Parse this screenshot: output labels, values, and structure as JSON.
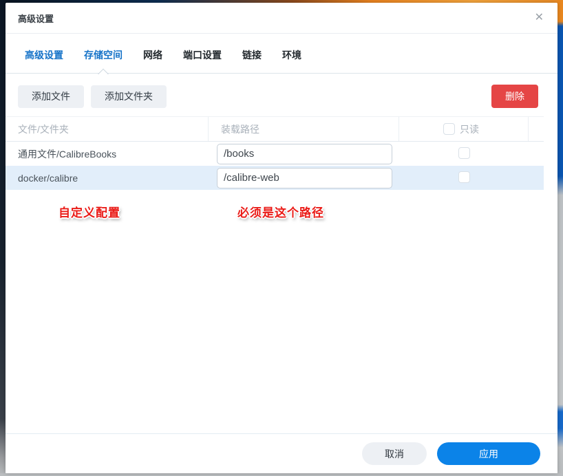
{
  "dialog": {
    "title": "高级设置",
    "close_icon": "✕"
  },
  "tabs": [
    {
      "label": "高级设置",
      "active": false
    },
    {
      "label": "存储空间",
      "active": true
    },
    {
      "label": "网络",
      "active": false
    },
    {
      "label": "端口设置",
      "active": false
    },
    {
      "label": "链接",
      "active": false
    },
    {
      "label": "环境",
      "active": false
    }
  ],
  "toolbar": {
    "add_file": "添加文件",
    "add_folder": "添加文件夹",
    "delete": "删除"
  },
  "table": {
    "headers": {
      "file": "文件/文件夹",
      "mount": "装载路径",
      "readonly": "只读"
    },
    "rows": [
      {
        "file": "通用文件/CalibreBooks",
        "mount_path": "/books",
        "readonly": false,
        "selected": false
      },
      {
        "file": "docker/calibre",
        "mount_path": "/calibre-web",
        "readonly": false,
        "selected": true
      }
    ]
  },
  "annotations": [
    {
      "text": "自定义配置"
    },
    {
      "text": "必须是这个路径"
    }
  ],
  "footer": {
    "cancel": "取消",
    "apply": "应用"
  },
  "colors": {
    "tab_blue": "#1673c8",
    "delete_red": "#e54545",
    "apply_blue": "#0b83e8",
    "selected_row": "#e2eefa",
    "annotation_red": "#ea1b17"
  }
}
